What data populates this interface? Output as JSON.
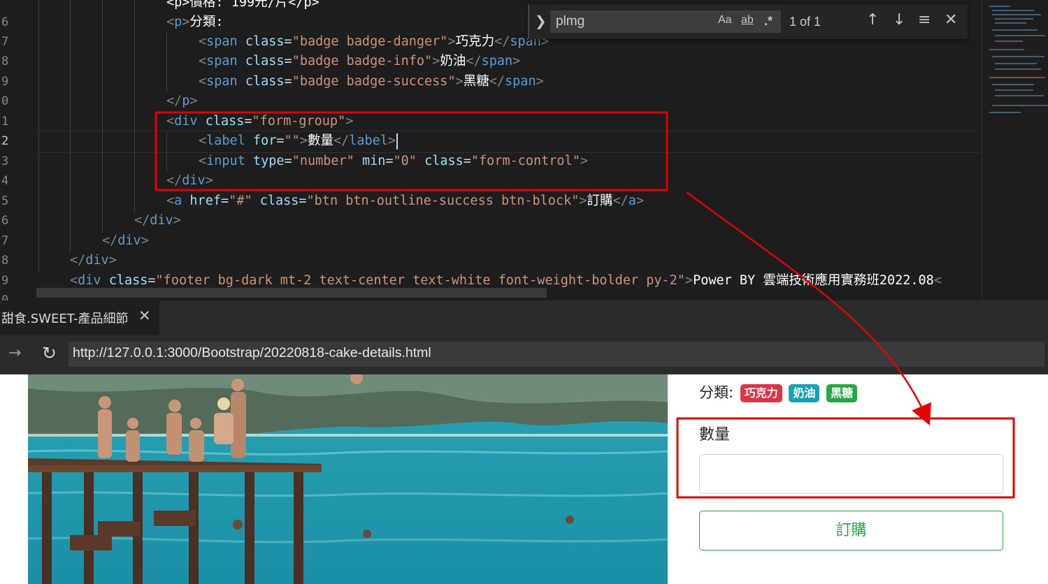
{
  "editor": {
    "line_numbers": [
      "6",
      "7",
      "8",
      "9",
      "0",
      "1",
      "2",
      "3",
      "4",
      "5",
      "6",
      "7",
      "8",
      "9",
      "0"
    ],
    "active_line_number": "2",
    "lines": {
      "l0_text": "<p>價格: 199元/片</p>",
      "l1_open": "<p>",
      "l1_text": "分類:",
      "l2_class_val": "\"badge badge-danger\"",
      "l2_text": "巧克力",
      "l3_class_val": "\"badge badge-info\"",
      "l3_text": "奶油",
      "l4_class_val": "\"badge badge-success\"",
      "l4_text": "黑糖",
      "l5_close": "</p>",
      "l6_class_val": "\"form-group\"",
      "l7_for_val": "\"\"",
      "l7_text": "數量",
      "l8_type_val": "\"number\"",
      "l8_min_val": "\"0\"",
      "l8_class_val": "\"form-control\"",
      "l9_close": "</div>",
      "l10_href_val": "\"#\"",
      "l10_class_val": "\"btn btn-outline-success btn-block\"",
      "l10_text": "訂購",
      "l11_close": "</div>",
      "l12_close": "</div>",
      "l13_close": "</div>",
      "l14_class_val": "\"footer bg-dark mt-2 text-center text-white font-weight-bolder py-2\"",
      "l14_text": "Power BY 雲端技術應用實務班2022.08"
    }
  },
  "find_widget": {
    "query": "plmg",
    "match_case_label": "Aa",
    "whole_word_label": "ab",
    "regex_label": ".*",
    "result_count": "1 of 1"
  },
  "browser": {
    "tab_title": "甜食.SWEET-產品細節",
    "url": "http://127.0.0.1:3000/Bootstrap/20220818-cake-details.html"
  },
  "product": {
    "category_label": "分類:",
    "badges": [
      {
        "text": "巧克力",
        "color": "#dc3545"
      },
      {
        "text": "奶油",
        "color": "#17a2b8"
      },
      {
        "text": "黑糖",
        "color": "#28a745"
      }
    ],
    "quantity_label": "數量",
    "quantity_value": "",
    "order_button": "訂購"
  },
  "colors": {
    "annotation_red": "#e00000",
    "success_green": "#28a745"
  }
}
